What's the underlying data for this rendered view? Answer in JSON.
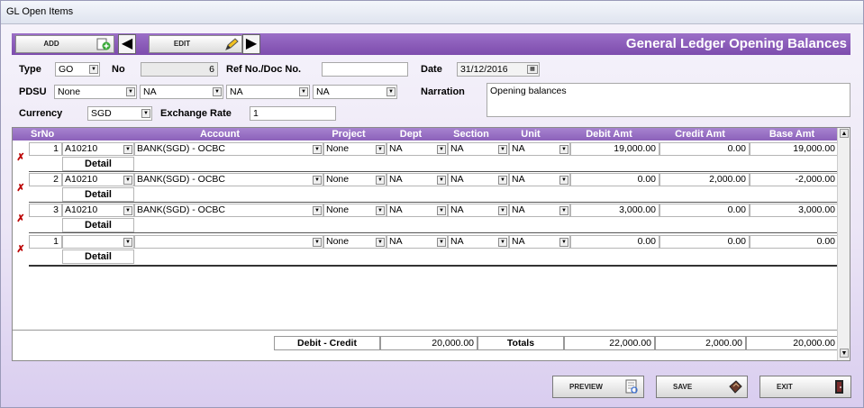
{
  "window": {
    "title": "GL Open Items"
  },
  "toolbar": {
    "add_label": "ADD",
    "edit_label": "EDIT",
    "heading": "General Ledger Opening Balances"
  },
  "form": {
    "type_label": "Type",
    "type_value": "GO",
    "no_label": "No",
    "no_value": "6",
    "ref_label": "Ref No./Doc No.",
    "ref_value": "",
    "date_label": "Date",
    "date_value": "31/12/2016",
    "pdsu_label": "PDSU",
    "pdsu_values": [
      "None",
      "NA",
      "NA",
      "NA"
    ],
    "narration_label": "Narration",
    "narration_value": "Opening balances",
    "currency_label": "Currency",
    "currency_value": "SGD",
    "rate_label": "Exchange Rate",
    "rate_value": "1"
  },
  "grid": {
    "headers": [
      "SrNo",
      "Account",
      "Project",
      "Dept",
      "Section",
      "Unit",
      "Debit Amt",
      "Credit Amt",
      "Base Amt"
    ],
    "detail_label": "Detail",
    "rows": [
      {
        "srno": "1",
        "code": "A10210",
        "account": "BANK(SGD) - OCBC",
        "project": "None",
        "dept": "NA",
        "section": "NA",
        "unit": "NA",
        "debit": "19,000.00",
        "credit": "0.00",
        "base": "19,000.00"
      },
      {
        "srno": "2",
        "code": "A10210",
        "account": "BANK(SGD) - OCBC",
        "project": "None",
        "dept": "NA",
        "section": "NA",
        "unit": "NA",
        "debit": "0.00",
        "credit": "2,000.00",
        "base": "-2,000.00"
      },
      {
        "srno": "3",
        "code": "A10210",
        "account": "BANK(SGD) - OCBC",
        "project": "None",
        "dept": "NA",
        "section": "NA",
        "unit": "NA",
        "debit": "3,000.00",
        "credit": "0.00",
        "base": "3,000.00"
      },
      {
        "srno": "1",
        "code": "",
        "account": "",
        "project": "None",
        "dept": "NA",
        "section": "NA",
        "unit": "NA",
        "debit": "0.00",
        "credit": "0.00",
        "base": "0.00"
      }
    ]
  },
  "totals": {
    "diff_label": "Debit - Credit",
    "diff_value": "20,000.00",
    "totals_label": "Totals",
    "debit": "22,000.00",
    "credit": "2,000.00",
    "base": "20,000.00"
  },
  "buttons": {
    "preview": "PREVIEW",
    "save": "SAVE",
    "exit": "EXIT"
  },
  "colors": {
    "accent": "#8c61ba",
    "delete": "#b00000"
  }
}
